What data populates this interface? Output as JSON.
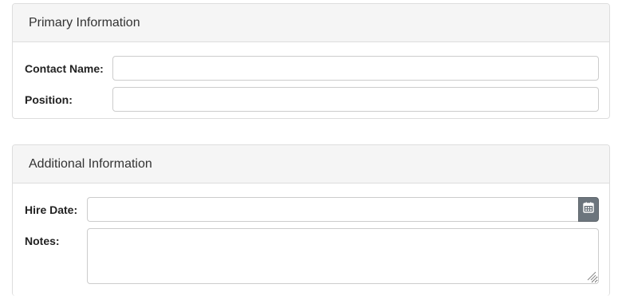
{
  "primary": {
    "heading": "Primary Information",
    "contact_name_label": "Contact Name:",
    "contact_name_value": "",
    "position_label": "Position:",
    "position_value": ""
  },
  "additional": {
    "heading": "Additional Information",
    "hire_date_label": "Hire Date:",
    "hire_date_value": "",
    "notes_label": "Notes:",
    "notes_value": ""
  },
  "icons": {
    "calendar": "calendar-icon",
    "resize": "resize-grip-icon"
  },
  "colors": {
    "panel_heading_bg": "#f5f5f5",
    "border": "#dddddd",
    "calendar_button": "#6c757d"
  }
}
